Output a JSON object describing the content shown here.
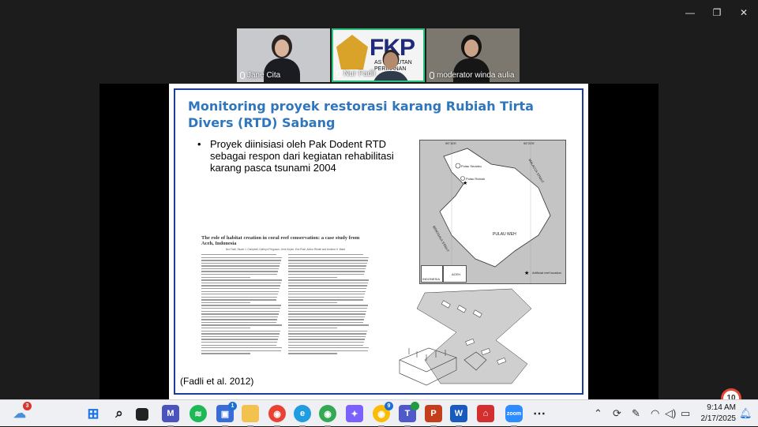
{
  "window": {
    "controls": [
      "minimize",
      "restore",
      "close"
    ]
  },
  "participants": [
    {
      "name": "Jane Cita",
      "muted": true
    },
    {
      "name": "Nur Fadli",
      "muted": true,
      "speaking": true
    },
    {
      "name": "moderator winda aulia",
      "muted": true
    }
  ],
  "logo": {
    "text": "FKP",
    "subtitle_1": "AS KELAUTAN",
    "subtitle_2": "PERIKANAN"
  },
  "slide": {
    "title": "Monitoring proyek restorasi karang Rubiah Tirta Divers (RTD) Sabang",
    "bullet": "Proyek diinisiasi oleh Pak Dodent RTD sebagai respon dari kegiatan rehabilitasi karang pasca tsunami 2004",
    "paper_title": "The role of habitat creation in coral reef conservation: a case study from Aceh, Indonesia",
    "paper_authors": "Nur Fadli, Stuart J. Campbell, Kathryn Ferguson, Jens Keyse, Emi Rudi, Arthur Riedel and Andrew H. Baird",
    "citation": "(Fadli et al. 2012)",
    "map_labels": {
      "lon_1": "95°15'E",
      "lon_2": "95°20'E",
      "strait_1": "MALACCA STRAIT",
      "strait_2": "BENGGALA STRAIT",
      "island": "PULAU WEH",
      "site_1": "Pulau Seulaku",
      "site_2": "Pulau Rubiah",
      "legend": "Artificial reef location",
      "inset_1": "INDONESIA",
      "inset_2": "ACEH"
    }
  },
  "notifications": {
    "count": "10"
  },
  "taskbar": {
    "weather_badge": "3",
    "apps": [
      {
        "name": "windows-start"
      },
      {
        "name": "search"
      },
      {
        "name": "task-view"
      },
      {
        "name": "teams-meet"
      },
      {
        "name": "spotify"
      },
      {
        "name": "app-store",
        "badge": "1"
      },
      {
        "name": "file-explorer"
      },
      {
        "name": "chrome-profile"
      },
      {
        "name": "edge"
      },
      {
        "name": "chrome"
      },
      {
        "name": "copilot"
      },
      {
        "name": "chrome-alt",
        "badge": "9"
      },
      {
        "name": "teams",
        "check": true
      },
      {
        "name": "powerpoint"
      },
      {
        "name": "word"
      },
      {
        "name": "mendeley"
      },
      {
        "name": "zoom"
      },
      {
        "name": "more"
      }
    ],
    "time": "9:14 AM",
    "date": "2/17/2025"
  }
}
